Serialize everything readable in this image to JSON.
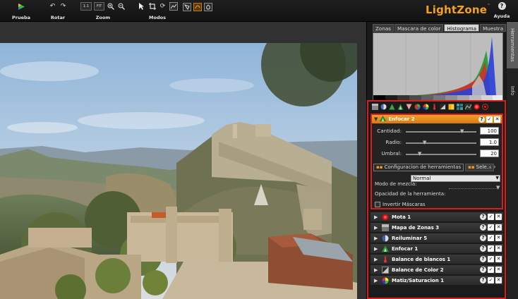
{
  "toolbar": {
    "groups": [
      {
        "label": "Prueba"
      },
      {
        "label": "Rotar"
      },
      {
        "label": "Zoom",
        "buttons": [
          "1:1",
          "FIT"
        ]
      },
      {
        "label": "Modos"
      }
    ]
  },
  "brand": "LightZone",
  "help_label": "Ayuda",
  "panel_tabs": [
    "Zonas",
    "Mascara de color",
    "Histograma",
    "Muestra"
  ],
  "side_tabs": [
    "Herramientas",
    "Info"
  ],
  "active_tool": {
    "title": "Enfocar 2",
    "sliders": [
      {
        "label": "Cantidad:",
        "value": "100",
        "level": 0.8
      },
      {
        "label": "Radio:",
        "value": "1.0",
        "level": 0.27
      },
      {
        "label": "Umbral:",
        "value": "20",
        "level": 0.2
      }
    ],
    "subtabs": [
      "Configuracion de herramientas",
      "Sele..."
    ],
    "blend_label": "Modo de mezcla:",
    "blend_value": "Normal",
    "opacity_label": "Opacidad de la herramienta:",
    "opacity_level": 1.0,
    "invert_label": "Invertir Máscaras"
  },
  "tool_list": [
    {
      "name": "Mota 1",
      "icon": "spot-icon"
    },
    {
      "name": "Mapa de Zonas 3",
      "icon": "zone-map-icon"
    },
    {
      "name": "Reiluminar 5",
      "icon": "relight-icon"
    },
    {
      "name": "Enfocar 1",
      "icon": "sharpen-icon"
    },
    {
      "name": "Balance de blancos 1",
      "icon": "white-balance-icon"
    },
    {
      "name": "Balance de Color 2",
      "icon": "color-balance-icon"
    },
    {
      "name": "Matiz/Saturacion 1",
      "icon": "hue-saturation-icon"
    }
  ],
  "colors": {
    "accent": "#e58c1a",
    "highlight_border": "#d61e1e",
    "brand": "#f4a21d"
  }
}
